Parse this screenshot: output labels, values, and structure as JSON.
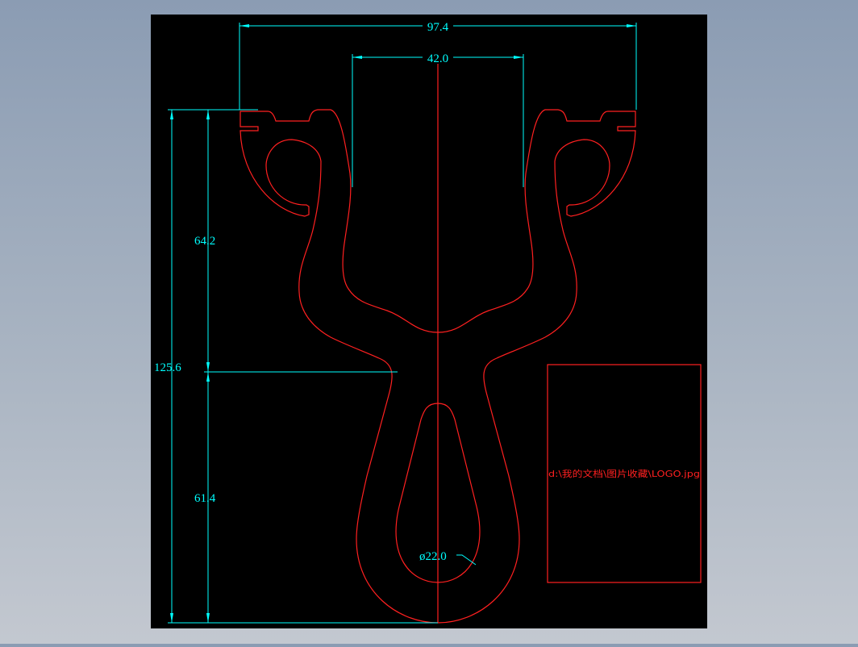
{
  "drawing": {
    "dimensions": {
      "overall_width": "97.4",
      "inner_width": "42.0",
      "overall_height": "125.6",
      "upper_height": "64.2",
      "lower_height": "61.4",
      "loop_diameter": "ø22.0"
    },
    "image_placeholder": {
      "path_text": "d:\\我的文档\\图片收藏\\LOGO.jpg"
    }
  },
  "colors": {
    "canvas": "#000000",
    "geometry": "#ff2020",
    "dimension": "#00ffff",
    "background_top": "#8b9cb3",
    "background_bottom": "#c3c8d0"
  }
}
